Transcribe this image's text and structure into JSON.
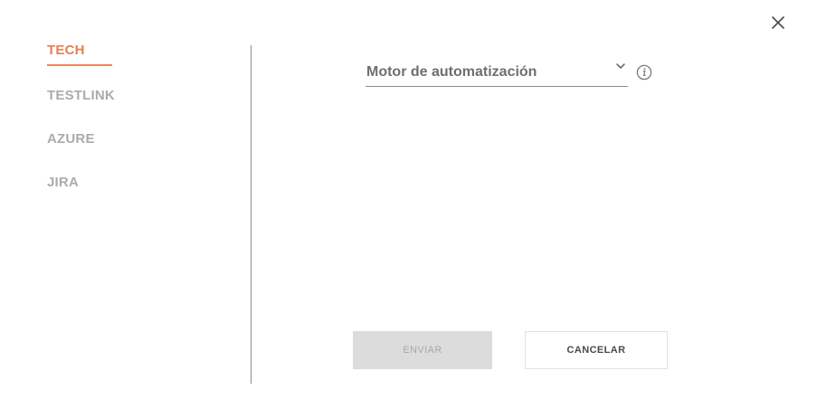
{
  "dialog": {
    "close_icon": "close-x-icon"
  },
  "tabs": [
    {
      "label": "TECH",
      "active": true
    },
    {
      "label": "TESTLINK",
      "active": false
    },
    {
      "label": "AZURE",
      "active": false
    },
    {
      "label": "JIRA",
      "active": false
    }
  ],
  "form": {
    "automation_engine": {
      "label": "Motor de automatización",
      "dropdown_icon": "chevron-down-icon",
      "info_icon": "info-icon"
    }
  },
  "actions": {
    "send_label": "ENVIAR",
    "send_disabled": true,
    "cancel_label": "CANCELAR"
  },
  "colors": {
    "accent": "#e47f56",
    "inactive_tab": "#ababab",
    "disabled_button_bg": "#dcdcdc"
  }
}
